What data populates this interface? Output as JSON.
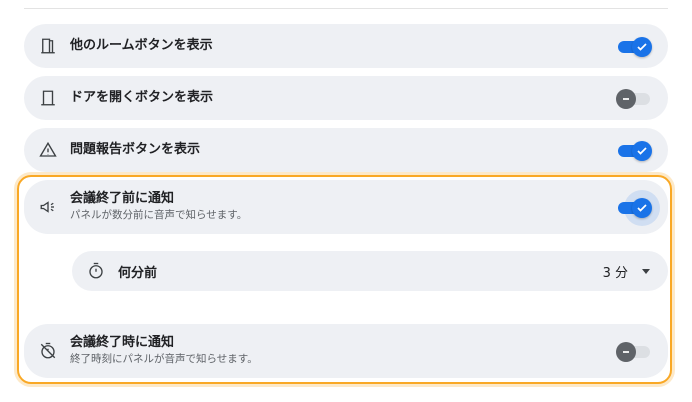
{
  "settings": {
    "items": [
      {
        "title": "他のルームボタンを表示",
        "icon": "door-icon",
        "enabled": true
      },
      {
        "title": "ドアを開くボタンを表示",
        "icon": "door-open-icon",
        "enabled": false
      },
      {
        "title": "問題報告ボタンを表示",
        "icon": "warning-icon",
        "enabled": true
      }
    ],
    "before_end": {
      "title": "会議終了前に通知",
      "subtitle": "パネルが数分前に音声で知らせます。",
      "icon": "megaphone-icon",
      "enabled": true,
      "minutes": {
        "label": "何分前",
        "icon": "timer-icon",
        "value": "3 分"
      }
    },
    "at_end": {
      "title": "会議終了時に通知",
      "subtitle": "終了時刻にパネルが音声で知らせます。",
      "icon": "timer-off-icon",
      "enabled": false
    }
  },
  "colors": {
    "accent": "#1a73e8",
    "highlight": "#f9a825",
    "row_background": "#eef0f4"
  }
}
